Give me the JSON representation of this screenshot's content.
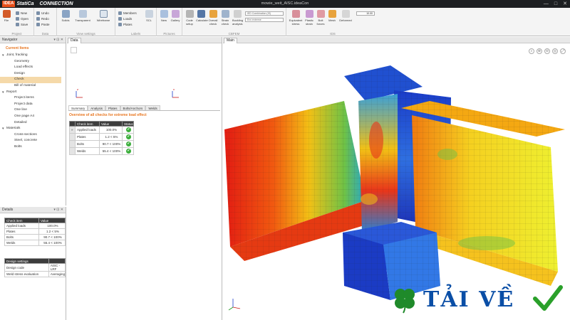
{
  "window": {
    "logo_idea": "IDEA",
    "logo_statica": "StatiCa",
    "logo_product": "CONNECTION",
    "title": "mowie_weit_AISC.ideaCon",
    "controls": [
      "—",
      "□",
      "✕"
    ]
  },
  "ribbon": {
    "groups": {
      "project": "Project",
      "data": "Data",
      "view_settings": "View settings",
      "labels": "Labels",
      "pictures": "Pictures",
      "cbfem": "CBFEM",
      "ids": "IDS"
    },
    "buttons": {
      "file": "File",
      "new": "New",
      "open": "Open",
      "save": "Save",
      "undo": "Undo",
      "redo": "Redo",
      "paste": "Paste",
      "solids": "Solids",
      "transparent": "Transparent",
      "wireframe": "Wireframe",
      "members": "Members",
      "loads": "Loads",
      "plates": "Plates",
      "scl": "SCL",
      "new_pic": "New",
      "gallery": "Gallery",
      "code_setup": "Code setup",
      "calculate": "Calculate",
      "overall_check": "Overall check",
      "strain_check": "Strain check",
      "buckling": "Buckling analysis",
      "equivalent_stress": "Equivalent stress",
      "plastic_strain": "Plastic strain",
      "bolt_forces": "Bolt forces",
      "mesh": "Mesh",
      "deformed": "Deformed"
    },
    "combo1": "IED Combination (IS)",
    "combo2": "Env extreme",
    "scale": "10.00"
  },
  "navigator": {
    "title": "Navigator",
    "current_items": "Current Items",
    "items": [
      {
        "label": "Joint, fracking",
        "group": true
      },
      {
        "label": "Geometry"
      },
      {
        "label": "Load effects"
      },
      {
        "label": "Design"
      },
      {
        "label": "Check",
        "selected": true
      },
      {
        "label": "Bill of material"
      },
      {
        "label": "Report",
        "group": true
      },
      {
        "label": "Project items"
      },
      {
        "label": "Project data"
      },
      {
        "label": "One line"
      },
      {
        "label": "One page A4"
      },
      {
        "label": "Detailed"
      },
      {
        "label": "Materials",
        "group": true
      },
      {
        "label": "Cross-sections"
      },
      {
        "label": "Steel, concrete"
      },
      {
        "label": "Bolts"
      }
    ]
  },
  "details": {
    "title": "Details",
    "check_table": {
      "headers": [
        "Check item",
        "Value"
      ],
      "rows": [
        [
          "Applied loads",
          "100.0%"
        ],
        [
          "Plates",
          "1.2 < 5%"
        ],
        [
          "Bolts",
          "90.7 < 100%"
        ],
        [
          "Welds",
          "55.4 < 100%"
        ]
      ]
    },
    "design_table": {
      "headers": [
        "Design settings",
        ""
      ],
      "rows": [
        [
          "Design code",
          "AISC - LRF"
        ],
        [
          "Weld stress evaluation",
          "Averaging"
        ]
      ]
    }
  },
  "data_panel": {
    "tab": "Data",
    "subtabs": [
      "Summary",
      "Analysis",
      "Plates",
      "Bolts/Anchors",
      "Welds"
    ],
    "overview": "Overview of all checks for extreme load effect",
    "table": {
      "headers": [
        "",
        "Check item",
        "Value",
        "Status"
      ],
      "rows": [
        [
          "»",
          "Applied loads",
          "100.0%",
          "✔"
        ],
        [
          "",
          "Plates",
          "1.2 < 5%",
          "✔"
        ],
        [
          "",
          "Bolts",
          "90.7 < 100%",
          "✔"
        ],
        [
          "",
          "Welds",
          "55.4 < 100%",
          "✔"
        ]
      ]
    },
    "axis_z": "z",
    "axis_x": "x"
  },
  "main_view": {
    "tab": "Main",
    "tools": [
      "⌕",
      "⊕",
      "⊖",
      "◎",
      "⤢"
    ]
  },
  "watermark": {
    "text": "TẢI VỀ",
    "colors": {
      "text": "#0a4ea6",
      "leaf": "#1f8a2a",
      "check": "#2aa02a"
    }
  },
  "colors": {
    "accent": "#e87722",
    "selection": "#f5d9a9",
    "ok": "#3cae3c",
    "titlebar": "#1d1f22"
  }
}
